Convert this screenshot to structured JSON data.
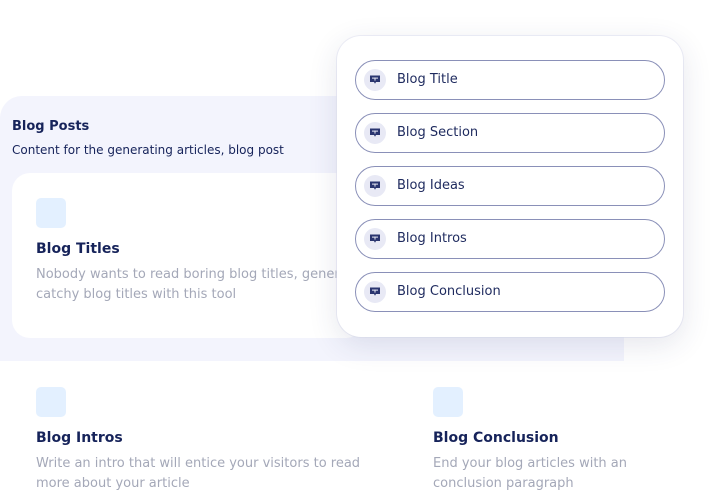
{
  "section": {
    "title": "Blog Posts",
    "subtitle": "Content for the generating articles, blog post"
  },
  "cards": [
    {
      "title": "Blog Titles",
      "description": "Nobody wants to read boring blog titles, generate catchy blog titles with this tool",
      "icon": "tool-icon"
    },
    {
      "title": "Blog Intros",
      "description": "Write an intro that will entice your visitors to read more about your article",
      "icon": "tool-icon"
    },
    {
      "title": "Blog Conclusion",
      "description": "End your blog articles with an conclusion paragraph",
      "icon": "tool-icon"
    }
  ],
  "dropdown": {
    "items": [
      {
        "label": "Blog Title",
        "icon": "chat-bubble-icon"
      },
      {
        "label": "Blog Section",
        "icon": "chat-bubble-icon"
      },
      {
        "label": "Blog Ideas",
        "icon": "chat-bubble-icon"
      },
      {
        "label": "Blog Intros",
        "icon": "chat-bubble-icon"
      },
      {
        "label": "Blog Conclusion",
        "icon": "chat-bubble-icon"
      }
    ]
  },
  "colors": {
    "primary_text": "#16235a",
    "muted_text": "#a4a8b8",
    "panel_bg": "#f3f4fd",
    "icon_tile": "#e3f0ff",
    "pill_border": "#8a90b8"
  }
}
